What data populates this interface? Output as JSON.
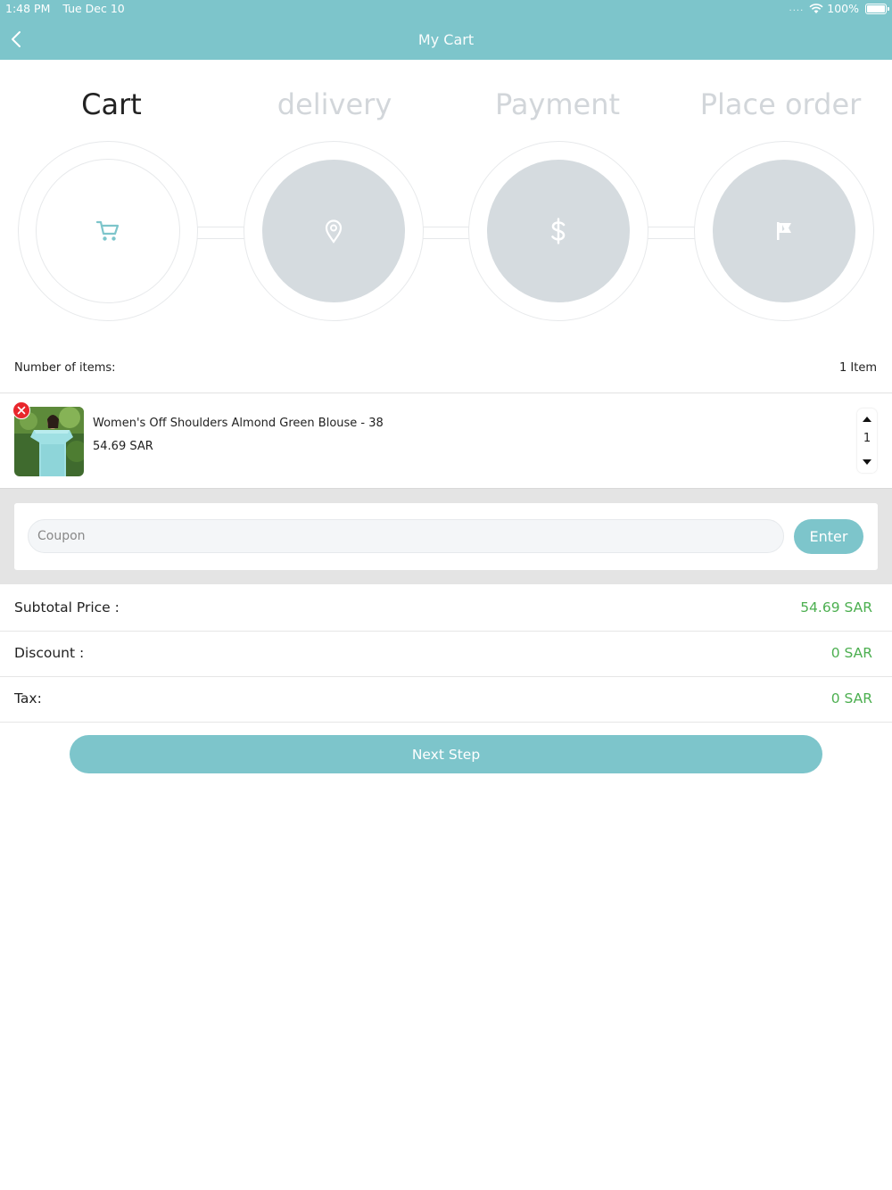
{
  "status_bar": {
    "time": "1:48 PM",
    "date": "Tue Dec 10",
    "battery": "100%"
  },
  "header": {
    "title": "My Cart",
    "back_icon": "chevron-left-icon"
  },
  "colors": {
    "primary": "#7dc5cb",
    "price_green": "#4caf50",
    "step_inactive": "#d5dbdf",
    "remove_red": "#e8262c"
  },
  "steps": [
    {
      "label": "Cart",
      "icon": "cart-icon",
      "active": true
    },
    {
      "label": "delivery",
      "icon": "location-pin-icon",
      "active": false
    },
    {
      "label": "Payment",
      "icon": "dollar-icon",
      "active": false
    },
    {
      "label": "Place order",
      "icon": "flag-icon",
      "active": false
    }
  ],
  "items_count": {
    "label": "Number of items:",
    "value": "1  Item"
  },
  "cart_item": {
    "name": "Women's Off Shoulders Almond Green Blouse - 38",
    "price": "54.69 SAR",
    "quantity": "1"
  },
  "coupon": {
    "placeholder": "Coupon",
    "button": "Enter"
  },
  "summary": {
    "subtotal_label": "Subtotal Price :",
    "subtotal_value": "54.69 SAR",
    "discount_label": "Discount :",
    "discount_value": "0 SAR",
    "tax_label": "Tax:",
    "tax_value": "0 SAR"
  },
  "next_button": "Next Step"
}
